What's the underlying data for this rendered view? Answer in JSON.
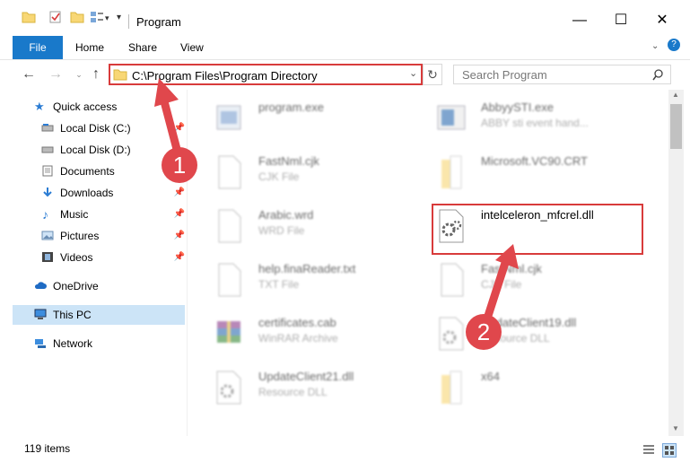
{
  "window": {
    "title": "Program",
    "minimize": "—",
    "maximize": "☐",
    "close": "✕"
  },
  "ribbon": {
    "tabs": [
      "File",
      "Home",
      "Share",
      "View"
    ],
    "help": "?"
  },
  "nav": {
    "address": "C:\\Program Files\\Program Directory",
    "search_placeholder": "Search Program"
  },
  "sidebar": {
    "items": [
      {
        "label": "Quick access",
        "icon": "star-icon"
      },
      {
        "label": "Local Disk (C:)",
        "icon": "drive-icon"
      },
      {
        "label": "Local Disk (D:)",
        "icon": "drive-icon"
      },
      {
        "label": "Documents",
        "icon": "documents-icon"
      },
      {
        "label": "Downloads",
        "icon": "download-icon"
      },
      {
        "label": "Music",
        "icon": "music-icon"
      },
      {
        "label": "Pictures",
        "icon": "pictures-icon"
      },
      {
        "label": "Videos",
        "icon": "videos-icon"
      },
      {
        "label": "OneDrive",
        "icon": "cloud-icon"
      },
      {
        "label": "This PC",
        "icon": "computer-icon"
      },
      {
        "label": "Network",
        "icon": "network-icon"
      }
    ]
  },
  "files": [
    {
      "name": "program.exe",
      "type": ""
    },
    {
      "name": "AbbyySTI.exe",
      "type": "ABBY sti event hand..."
    },
    {
      "name": "FastNml.cjk",
      "type": "CJK File"
    },
    {
      "name": "Microsoft.VC90.CRT",
      "type": ""
    },
    {
      "name": "Arabic.wrd",
      "type": "WRD File"
    },
    {
      "name": "intelceleron_mfcrel.dll",
      "type": ""
    },
    {
      "name": "help.finaReader.txt",
      "type": "TXT File"
    },
    {
      "name": "FastNml.cjk",
      "type": "CJK File"
    },
    {
      "name": "certificates.cab",
      "type": "WinRAR Archive"
    },
    {
      "name": "UpdateClient19.dll",
      "type": "Resource DLL"
    },
    {
      "name": "UpdateClient21.dll",
      "type": "Resource DLL"
    },
    {
      "name": "x64",
      "type": ""
    }
  ],
  "status": {
    "count": "119 items"
  },
  "callouts": {
    "one": "1",
    "two": "2"
  },
  "colors": {
    "accent": "#1979ca",
    "highlight": "#d83b3b",
    "badge": "#e0474c"
  }
}
